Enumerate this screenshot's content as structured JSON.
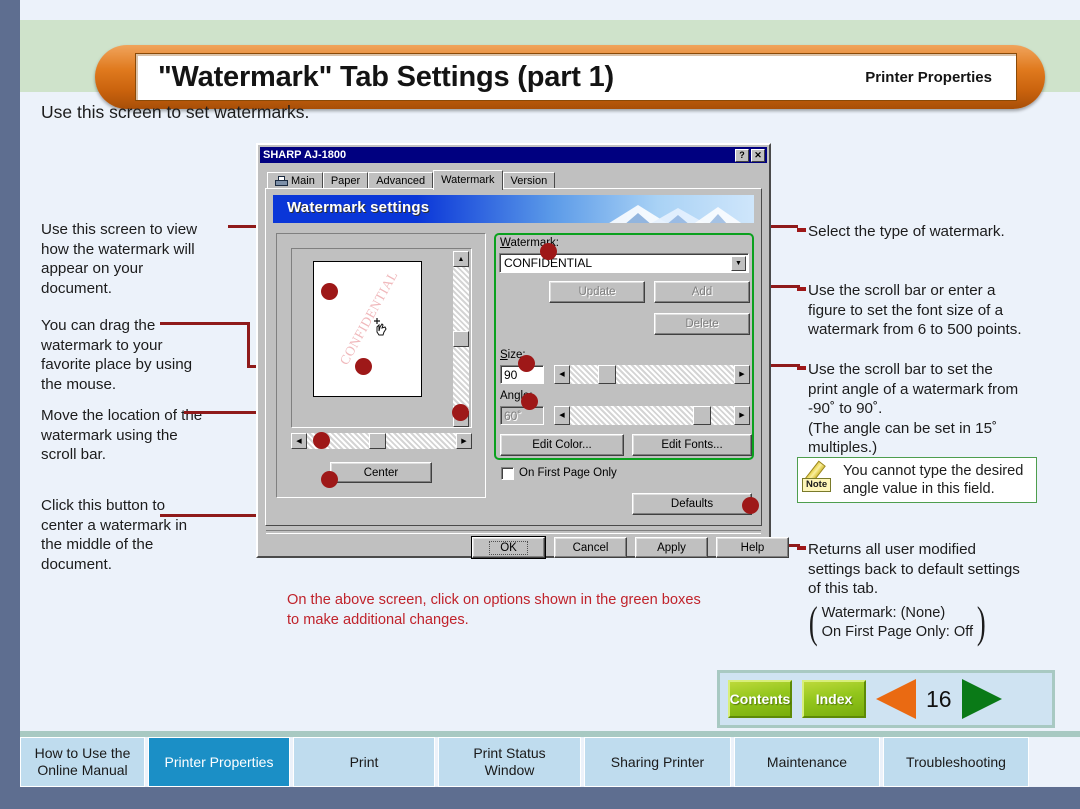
{
  "header": {
    "title": "\"Watermark\" Tab Settings (part 1)",
    "subtitle": "Printer Properties"
  },
  "intro": "Use this screen to set watermarks.",
  "annotations": {
    "left": [
      {
        "id": "preview-note",
        "text": "Use this screen to view\nhow the watermark will\nappear on your\ndocument."
      },
      {
        "id": "drag-note",
        "text": "You can drag the\nwatermark to your\nfavorite place by using\nthe mouse."
      },
      {
        "id": "scrollbar-note",
        "text": "Move the location of the\nwatermark using the\nscroll bar."
      },
      {
        "id": "center-note",
        "text": "Click this button to\ncenter a watermark in\nthe middle of the\ndocument."
      }
    ],
    "right": [
      {
        "id": "watermark-type-note",
        "text": "Select the type of watermark."
      },
      {
        "id": "size-note",
        "text": "Use the scroll bar or enter a\nfigure to set the font size of a\nwatermark from 6 to 500 points."
      },
      {
        "id": "angle-note",
        "text": "Use the scroll bar to set the\nprint angle of a watermark from\n-90˚ to 90˚.\n (The angle can be set in 15˚\nmultiples.)"
      },
      {
        "id": "defaults-note",
        "text": "Returns all user modified\nsettings back to default settings\nof this tab."
      }
    ]
  },
  "note_box": {
    "badge": "Note",
    "text": "You cannot type the desired\nangle value in this field."
  },
  "defaults_values": "Watermark: (None)\nOn First Page Only: Off",
  "red_caption": "On the above screen, click on options shown in the green boxes\nto make additional changes.",
  "dialog": {
    "title": "SHARP AJ-1800",
    "titlebar_buttons": [
      "?",
      "✕"
    ],
    "tabs": [
      {
        "label": "Main",
        "icon": "printer-icon",
        "active": false
      },
      {
        "label": "Paper",
        "active": false
      },
      {
        "label": "Advanced",
        "active": false
      },
      {
        "label": "Watermark",
        "active": true
      },
      {
        "label": "Version",
        "active": false
      }
    ],
    "panel_banner": "Watermark settings",
    "preview": {
      "watermark_preview_text": "CONFIDENTIAL",
      "center_button": "Center"
    },
    "fields": {
      "watermark_label": "Watermark:",
      "watermark_value": "CONFIDENTIAL",
      "update_button": "Update",
      "add_button": "Add",
      "delete_button": "Delete",
      "size_label": "Size:",
      "size_value": "90",
      "angle_label": "Angle:",
      "angle_value": "60˚",
      "edit_color_button": "Edit Color...",
      "edit_fonts_button": "Edit Fonts...",
      "first_page_checkbox": "On First Page Only",
      "defaults_button": "Defaults"
    },
    "footer_buttons": [
      "OK",
      "Cancel",
      "Apply",
      "Help"
    ]
  },
  "nav": {
    "contents": "Contents",
    "index": "Index",
    "page": "16",
    "prev_icon": "triangle-left-icon",
    "next_icon": "triangle-right-icon"
  },
  "bottom_tabs": [
    {
      "label": "How to Use the\nOnline Manual",
      "active": false,
      "width": 125
    },
    {
      "label": "Printer Properties",
      "active": true,
      "width": 142
    },
    {
      "label": "Print",
      "active": false,
      "width": 142
    },
    {
      "label": "Print Status\nWindow",
      "active": false,
      "width": 143
    },
    {
      "label": "Sharing Printer",
      "active": false,
      "width": 147
    },
    {
      "label": "Maintenance",
      "active": false,
      "width": 146
    },
    {
      "label": "Troubleshooting",
      "active": false,
      "width": 146
    }
  ],
  "colors": {
    "page_border": "#5e6e90",
    "header_band": "#cfe3cb",
    "banner_orange": "#e07a1e",
    "callout_red": "#9e1818",
    "caption_red": "#c0232b",
    "green_box": "#0aa11e",
    "active_tab_blue": "#1b8fc6",
    "nav_green": "#93c61c",
    "prev_orange": "#ea6a12",
    "next_green": "#0a7a17"
  }
}
